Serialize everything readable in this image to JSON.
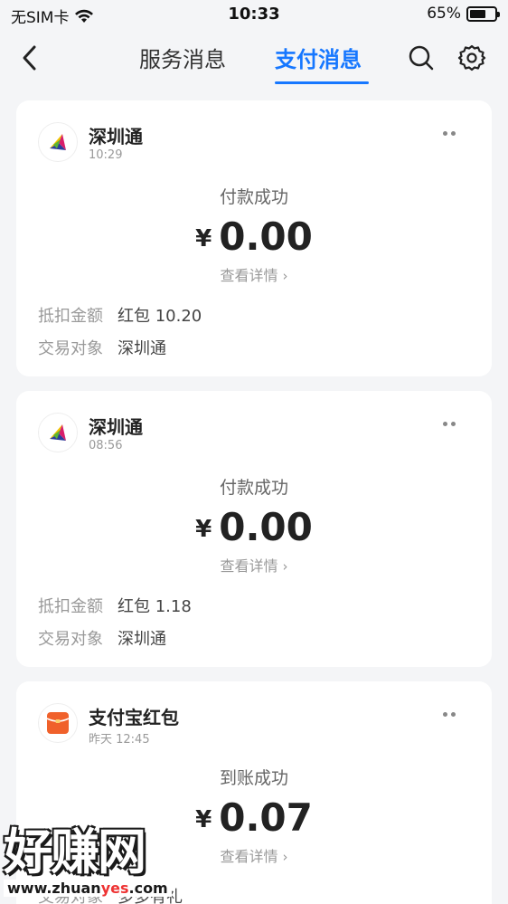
{
  "status_bar": {
    "carrier": "无SIM卡",
    "time": "10:33",
    "battery": "65%",
    "battery_level": 0.65
  },
  "nav": {
    "tabs": [
      {
        "label": "服务消息",
        "active": false
      },
      {
        "label": "支付消息",
        "active": true
      }
    ],
    "icons": [
      "back-icon",
      "search-icon",
      "gear-icon"
    ]
  },
  "cards": [
    {
      "merchant": "深圳通",
      "time": "10:29",
      "status": "付款成功",
      "currency": "¥",
      "amount": "0.00",
      "detail_label": "查看详情",
      "rows": [
        {
          "label": "抵扣金额",
          "value": "红包 10.20"
        },
        {
          "label": "交易对象",
          "value": "深圳通"
        }
      ]
    },
    {
      "merchant": "深圳通",
      "time": "08:56",
      "status": "付款成功",
      "currency": "¥",
      "amount": "0.00",
      "detail_label": "查看详情",
      "rows": [
        {
          "label": "抵扣金额",
          "value": "红包 1.18"
        },
        {
          "label": "交易对象",
          "value": "深圳通"
        }
      ]
    },
    {
      "merchant": "支付宝红包",
      "time": "昨天 12:45",
      "status": "到账成功",
      "currency": "¥",
      "amount": "0.07",
      "detail_label": "查看详情",
      "rows": [
        {
          "label": "交易对象",
          "value": "多多有礼"
        }
      ]
    }
  ],
  "watermark": {
    "text": "好赚网",
    "url_prefix": "www.zhuan",
    "url_highlight": "yes",
    "url_suffix": ".com"
  },
  "colors": {
    "accent": "#1677ff",
    "background": "#f4f5f7",
    "redpacket": "#f0612b"
  }
}
